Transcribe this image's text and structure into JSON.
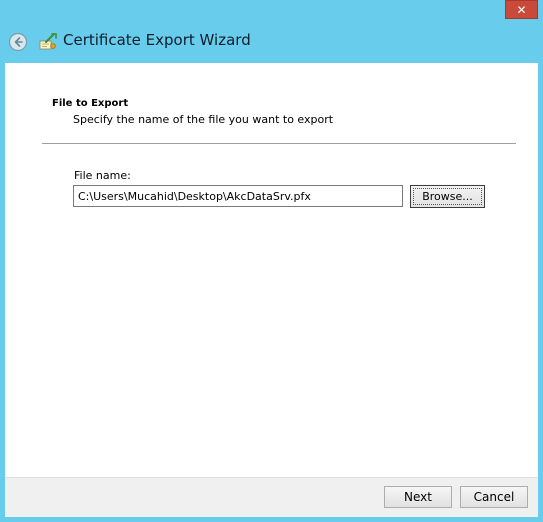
{
  "window": {
    "title": "Certificate Export Wizard",
    "close_glyph": "✕",
    "colors": {
      "frame": "#68cdec",
      "close": "#c9493b",
      "content": "#ffffff",
      "footer": "#f0f0f0"
    }
  },
  "page": {
    "heading": "File to Export",
    "description": "Specify the name of the file you want to export"
  },
  "file": {
    "label": "File name:",
    "value": "C:\\Users\\Mucahid\\Desktop\\AkcDataSrv.pfx"
  },
  "buttons": {
    "browse": "Browse...",
    "next": "Next",
    "cancel": "Cancel"
  },
  "icons": {
    "back": "back-arrow-icon",
    "wizard": "certificate-wizard-icon",
    "close": "close-icon"
  }
}
